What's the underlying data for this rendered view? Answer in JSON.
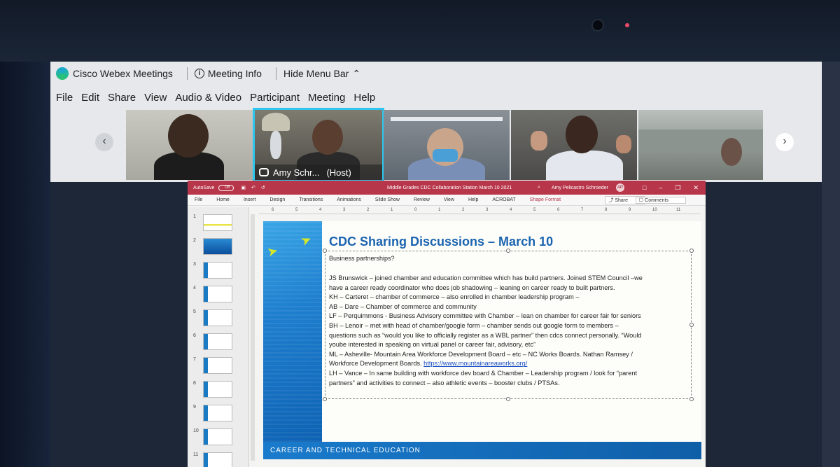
{
  "webex": {
    "app_name": "Cisco Webex Meetings",
    "meeting_info": "Meeting Info",
    "hide_menu_bar": "Hide Menu Bar",
    "menu": [
      "File",
      "Edit",
      "Share",
      "View",
      "Audio & Video",
      "Participant",
      "Meeting",
      "Help"
    ],
    "host_label_name": "Amy Schr...",
    "host_label_role": "(Host)"
  },
  "ppt": {
    "autosave": "AutoSave",
    "autosave_state": "Off",
    "doc_title": "Middle Grades CDC Collaboration Station March 10 2021",
    "user_name": "Amy Pelicastro Schroeder",
    "user_initials": "AP",
    "ribbon_tabs": [
      "File",
      "Home",
      "Insert",
      "Design",
      "Transitions",
      "Animations",
      "Slide Show",
      "Review",
      "View",
      "Help",
      "ACROBAT",
      "Shape Format"
    ],
    "share_button": "Share",
    "comments_button": "Comments",
    "ruler_ticks": [
      "6",
      "5",
      "4",
      "3",
      "2",
      "1",
      "0",
      "1",
      "2",
      "3",
      "4",
      "5",
      "6",
      "7",
      "8",
      "9",
      "10",
      "11"
    ],
    "thumb_numbers": [
      "1",
      "2",
      "3",
      "4",
      "5",
      "6",
      "7",
      "8",
      "9",
      "10",
      "11"
    ]
  },
  "slide": {
    "title": "CDC Sharing Discussions – March 10",
    "subtitle": "Business partnerships?",
    "lines": [
      "JS Brunswick – joined chamber and education committee which has build partners. Joined STEM Council –we",
      "have a career ready coordinator who does job shadowing – leaning on career ready to built partners.",
      "KH – Carteret – chamber of commerce – also enrolled in chamber leadership program –",
      "AB – Dare – Chamber of commerce and community",
      "LF – Perquimmons - Business Advisory committee with Chamber – lean on chamber for career fair for seniors",
      "BH – Lenoir – met with head of chamber/google form – chamber sends out google form to members –",
      "questions such as “would you like to officially register as a WBL partner” then cdcs connect personally. “Would",
      "yoube interested in speaking on virtual panel or career fair, advisory, etc”",
      "ML – Asheville- Mountain Area Workforce Development Board – etc – NC Works Boards. Nathan Ramsey  /",
      "Workforce Development Boards."
    ],
    "link": "https://www.mountainareaworks.org/",
    "lines_after": [
      "LH – Vance – In same building with workforce dev board & Chamber – Leadership program / look for “parent",
      "partners” and activities to connect – also athletic events – booster clubs / PTSAs."
    ],
    "footer": "CAREER AND TECHNICAL EDUCATION"
  }
}
